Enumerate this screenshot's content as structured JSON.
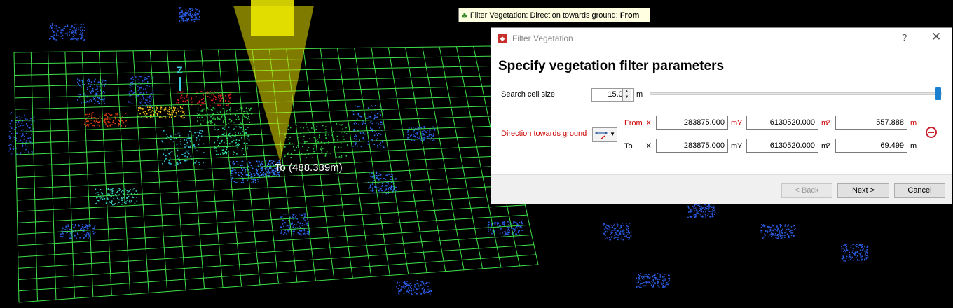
{
  "viewport": {
    "measure_label": "To (488.339m)",
    "axis_label": "Z"
  },
  "tooltip": {
    "icon": "tree-icon",
    "prefix": "Filter Vegetation: Direction towards ground:",
    "value": "From"
  },
  "dialog": {
    "title": "Filter Vegetation",
    "help": "?",
    "close": "✕",
    "heading": "Specify vegetation filter parameters",
    "search_cell": {
      "label": "Search cell size",
      "value": "15.000",
      "unit": "m",
      "slider_fraction": 1.0
    },
    "direction": {
      "label": "Direction towards ground",
      "from_label": "From",
      "to_label": "To",
      "x_label": "X",
      "y_label": "Y",
      "z_label": "Z",
      "unit": "m",
      "from": {
        "x": "283875.000",
        "y": "6130520.000",
        "z": "557.888"
      },
      "to": {
        "x": "283875.000",
        "y": "6130520.000",
        "z": "69.499"
      }
    },
    "buttons": {
      "back": "< Back",
      "next": "Next >",
      "cancel": "Cancel"
    },
    "colors": {
      "accent": "#1b80d0",
      "required_label": "#cc0000"
    }
  }
}
